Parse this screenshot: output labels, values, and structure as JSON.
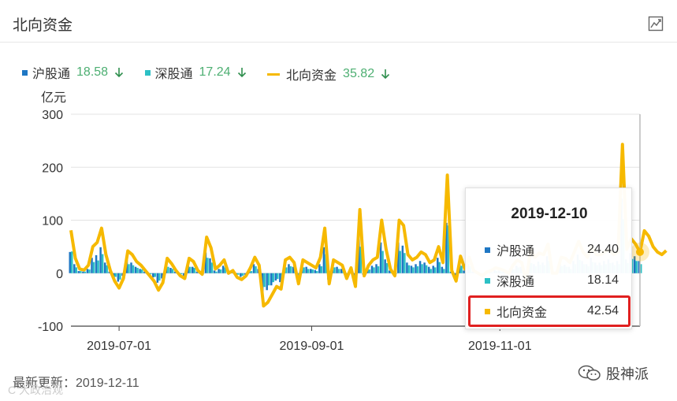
{
  "header": {
    "title": "北向资金"
  },
  "legend": [
    {
      "name": "沪股通",
      "value": "18.58",
      "color": "#1f77c4"
    },
    {
      "name": "深股通",
      "value": "17.24",
      "color": "#2cc0c5"
    },
    {
      "name": "北向资金",
      "value": "35.82",
      "color": "#f6b900"
    }
  ],
  "tooltip": {
    "date": "2019-12-10",
    "rows": [
      {
        "name": "沪股通",
        "value": "24.40"
      },
      {
        "name": "深股通",
        "value": "18.14"
      },
      {
        "name": "北向资金",
        "value": "42.54"
      }
    ]
  },
  "footer": {
    "updated": "最新更新：2019-12-11",
    "watermark": "C 大政治观",
    "brand": "股神派"
  },
  "colors": {
    "sh": "#1f77c4",
    "sz": "#2cc0c5",
    "total": "#f6b900",
    "down": "#4daf72",
    "highlight": "#e02020"
  },
  "chart_data": {
    "type": "bar",
    "ylabel": "亿元",
    "ylim": [
      -100,
      300
    ],
    "yticks": [
      300,
      200,
      100,
      0,
      -100
    ],
    "xticks": [
      {
        "label": "2019-07-01",
        "index": 11
      },
      {
        "label": "2019-09-01",
        "index": 55
      },
      {
        "label": "2019-11-01",
        "index": 98
      }
    ],
    "n_points": 131,
    "total": [
      81,
      28,
      8,
      6,
      15,
      50,
      58,
      85,
      35,
      5,
      -15,
      -28,
      -10,
      42,
      35,
      22,
      15,
      5,
      -5,
      -15,
      -32,
      -18,
      28,
      18,
      5,
      -5,
      -10,
      28,
      22,
      5,
      -2,
      68,
      48,
      8,
      15,
      25,
      0,
      5,
      -8,
      -12,
      -5,
      10,
      30,
      15,
      -62,
      -55,
      -40,
      -25,
      -30,
      25,
      30,
      20,
      -20,
      25,
      20,
      15,
      10,
      30,
      85,
      -20,
      25,
      20,
      15,
      -10,
      10,
      -25,
      120,
      -5,
      15,
      25,
      30,
      100,
      45,
      8,
      -5,
      100,
      90,
      35,
      25,
      30,
      40,
      35,
      20,
      25,
      50,
      20,
      185,
      5,
      -15,
      32,
      8,
      30,
      5,
      0,
      -5,
      2,
      5,
      10,
      8,
      5,
      0,
      15,
      25,
      20,
      -15,
      45,
      30,
      38,
      35,
      55,
      0,
      0,
      30,
      28,
      20,
      40,
      60,
      40,
      30,
      50,
      35,
      35,
      40,
      45,
      35,
      40,
      243,
      45,
      65,
      55,
      40,
      80,
      70,
      50,
      40,
      35,
      42.54
    ],
    "series": [
      {
        "name": "沪股通",
        "values": [
          40,
          17,
          4,
          3,
          8,
          29,
          34,
          49,
          20,
          3,
          -8,
          -16,
          -5,
          25,
          20,
          12,
          8,
          3,
          -3,
          -8,
          -18,
          -10,
          16,
          10,
          3,
          -3,
          -5,
          16,
          12,
          3,
          -1,
          39,
          28,
          5,
          8,
          14,
          0,
          3,
          -5,
          -7,
          -3,
          6,
          17,
          8,
          -36,
          -32,
          -23,
          -14,
          -17,
          14,
          17,
          12,
          -12,
          14,
          12,
          8,
          6,
          17,
          49,
          -12,
          14,
          12,
          8,
          -6,
          6,
          -14,
          70,
          -3,
          8,
          14,
          17,
          58,
          26,
          5,
          -3,
          58,
          52,
          20,
          14,
          17,
          23,
          20,
          12,
          14,
          29,
          12,
          95,
          3,
          -8,
          18,
          5,
          17,
          3,
          0,
          -3,
          1,
          3,
          6,
          5,
          3,
          0,
          8,
          14,
          12,
          -8,
          26,
          17,
          22,
          20,
          32,
          0,
          0,
          17,
          16,
          12,
          23,
          35,
          23,
          17,
          29,
          20,
          20,
          23,
          26,
          20,
          23,
          141,
          26,
          38,
          32,
          23,
          46,
          41,
          29,
          23,
          20,
          24.4
        ]
      },
      {
        "name": "深股通",
        "values": [
          41,
          11,
          4,
          3,
          7,
          21,
          24,
          36,
          15,
          2,
          -7,
          -12,
          -5,
          17,
          15,
          10,
          7,
          2,
          -2,
          -7,
          -14,
          -8,
          12,
          8,
          2,
          -2,
          -5,
          12,
          10,
          2,
          -1,
          29,
          20,
          3,
          7,
          11,
          0,
          2,
          -3,
          -5,
          -2,
          4,
          13,
          7,
          -26,
          -23,
          -17,
          -11,
          -13,
          11,
          13,
          8,
          -8,
          11,
          8,
          7,
          4,
          13,
          36,
          -8,
          11,
          8,
          7,
          -4,
          4,
          -11,
          50,
          -2,
          7,
          11,
          13,
          42,
          19,
          3,
          -2,
          42,
          38,
          15,
          11,
          13,
          17,
          15,
          8,
          11,
          21,
          8,
          90,
          2,
          -7,
          14,
          3,
          13,
          2,
          0,
          -2,
          1,
          2,
          4,
          3,
          2,
          0,
          7,
          11,
          8,
          -7,
          19,
          13,
          16,
          15,
          23,
          0,
          0,
          13,
          12,
          8,
          17,
          25,
          17,
          13,
          21,
          15,
          15,
          17,
          19,
          15,
          17,
          102,
          19,
          27,
          23,
          17,
          34,
          29,
          21,
          17,
          15,
          18.14
        ]
      }
    ]
  }
}
